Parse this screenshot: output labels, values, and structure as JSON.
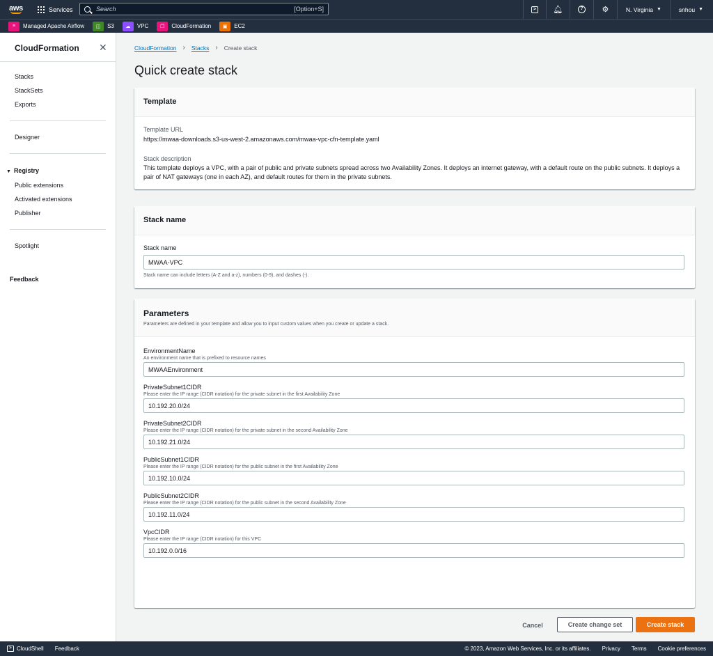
{
  "topnav": {
    "logo": "aws",
    "services_label": "Services",
    "search_placeholder": "Search",
    "search_shortcut": "[Option+S]",
    "icons": [
      "cloudshell-icon",
      "bell-icon",
      "help-icon",
      "gear-icon"
    ],
    "region": "N. Virginia",
    "user": "snhou"
  },
  "favorites": [
    {
      "label": "Managed Apache Airflow",
      "color": "#e7157b",
      "icon": "airflow-icon"
    },
    {
      "label": "S3",
      "color": "#3f8624",
      "icon": "s3-icon"
    },
    {
      "label": "VPC",
      "color": "#8c4fff",
      "icon": "vpc-icon"
    },
    {
      "label": "CloudFormation",
      "color": "#e7157b",
      "icon": "cloudformation-icon"
    },
    {
      "label": "EC2",
      "color": "#ed7100",
      "icon": "ec2-icon"
    }
  ],
  "sidebar": {
    "title": "CloudFormation",
    "items": [
      "Stacks",
      "StackSets",
      "Exports"
    ],
    "designer": "Designer",
    "registry_label": "Registry",
    "registry_items": [
      "Public extensions",
      "Activated extensions",
      "Publisher"
    ],
    "spotlight": "Spotlight",
    "feedback": "Feedback"
  },
  "breadcrumb": [
    "CloudFormation",
    "Stacks",
    "Create stack"
  ],
  "page_title": "Quick create stack",
  "template": {
    "heading": "Template",
    "url_label": "Template URL",
    "url_value": "https://mwaa-downloads.s3-us-west-2.amazonaws.com/mwaa-vpc-cfn-template.yaml",
    "desc_label": "Stack description",
    "desc_value": "This template deploys a VPC, with a pair of public and private subnets spread across two Availability Zones. It deploys an internet gateway, with a default route on the public subnets. It deploys a pair of NAT gateways (one in each AZ), and default routes for them in the private subnets."
  },
  "stackname": {
    "heading": "Stack name",
    "label": "Stack name",
    "value": "MWAA-VPC",
    "hint": "Stack name can include letters (A-Z and a-z), numbers (0-9), and dashes (-)."
  },
  "parameters": {
    "heading": "Parameters",
    "description": "Parameters are defined in your template and allow you to input custom values when you create or update a stack.",
    "items": [
      {
        "name": "EnvironmentName",
        "hint": "An environment name that is prefixed to resource names",
        "value": "MWAAEnvironment"
      },
      {
        "name": "PrivateSubnet1CIDR",
        "hint": "Please enter the IP range (CIDR notation) for the private subnet in the first Availability Zone",
        "value": "10.192.20.0/24"
      },
      {
        "name": "PrivateSubnet2CIDR",
        "hint": "Please enter the IP range (CIDR notation) for the private subnet in the second Availability Zone",
        "value": "10.192.21.0/24"
      },
      {
        "name": "PublicSubnet1CIDR",
        "hint": "Please enter the IP range (CIDR notation) for the public subnet in the first Availability Zone",
        "value": "10.192.10.0/24"
      },
      {
        "name": "PublicSubnet2CIDR",
        "hint": "Please enter the IP range (CIDR notation) for the public subnet in the second Availability Zone",
        "value": "10.192.11.0/24"
      },
      {
        "name": "VpcCIDR",
        "hint": "Please enter the IP range (CIDR notation) for this VPC",
        "value": "10.192.0.0/16"
      }
    ]
  },
  "actions": {
    "cancel": "Cancel",
    "create_change_set": "Create change set",
    "create_stack": "Create stack"
  },
  "footer": {
    "cloudshell": "CloudShell",
    "feedback": "Feedback",
    "copyright": "© 2023, Amazon Web Services, Inc. or its affiliates.",
    "privacy": "Privacy",
    "terms": "Terms",
    "cookies": "Cookie preferences"
  }
}
